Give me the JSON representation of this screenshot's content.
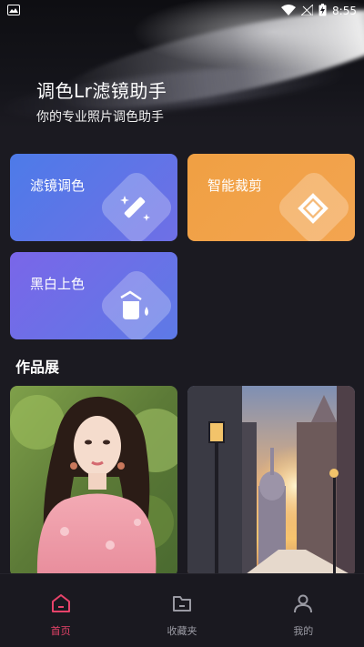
{
  "status_bar": {
    "time": "8:55"
  },
  "header": {
    "title": "调色Lr滤镜助手",
    "subtitle": "你的专业照片调色助手"
  },
  "features": [
    {
      "label": "滤镜调色",
      "icon": "magic-wand-icon",
      "color": "#5a78e8"
    },
    {
      "label": "智能裁剪",
      "icon": "crop-icon",
      "color": "#f2a147"
    },
    {
      "label": "黑白上色",
      "icon": "paint-bucket-icon",
      "color": "#6f6ee8"
    }
  ],
  "gallery": {
    "title": "作品展",
    "items": [
      {
        "icon": "portrait-photo"
      },
      {
        "icon": "city-sunset-photo"
      }
    ]
  },
  "tabbar": {
    "tabs": [
      {
        "label": "首页",
        "icon": "home-icon",
        "active": true
      },
      {
        "label": "收藏夹",
        "icon": "folder-icon",
        "active": false
      },
      {
        "label": "我的",
        "icon": "user-icon",
        "active": false
      }
    ],
    "active_color": "#e8436a"
  }
}
